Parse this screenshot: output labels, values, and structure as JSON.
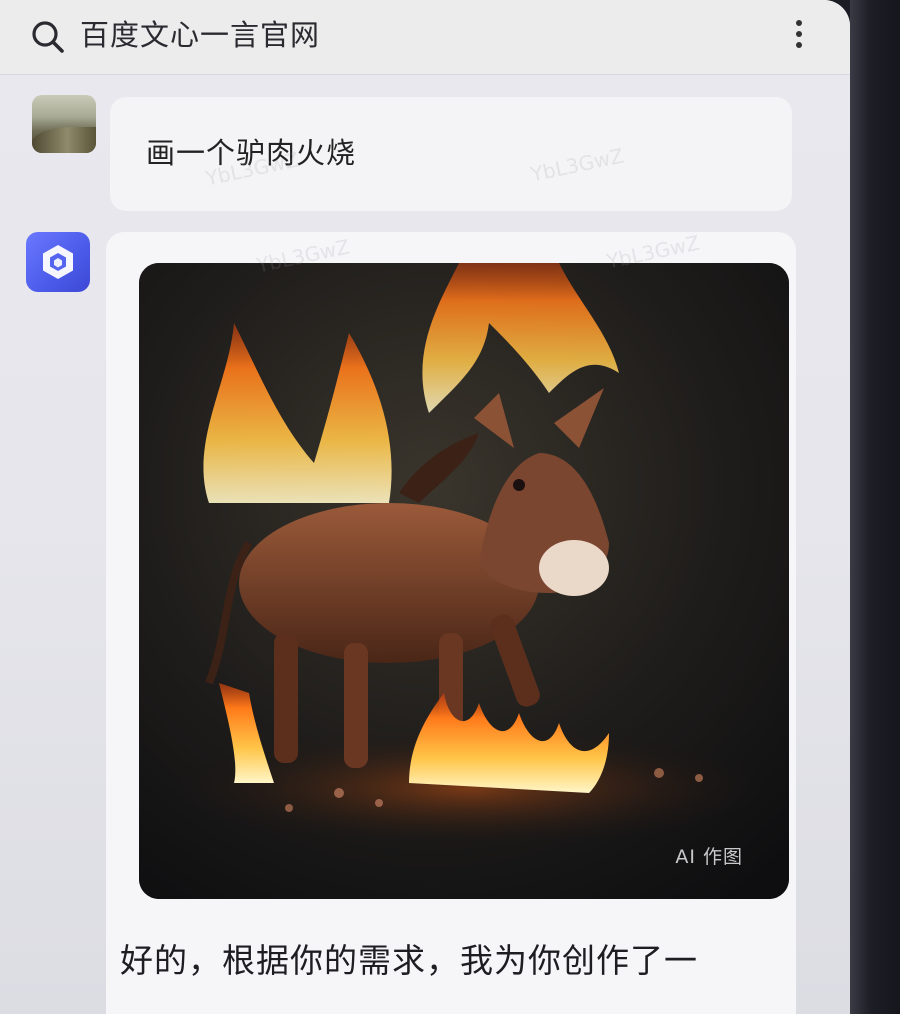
{
  "search": {
    "query": "百度文心一言官网",
    "icon": "search-icon",
    "menu_icon": "more-vertical-icon"
  },
  "conversation": {
    "user_message": "画一个驴肉火烧",
    "bot_image_label": "AI 作图",
    "bot_text": "好的，根据你的需求，我为你创作了一"
  },
  "watermarks": [
    "YbL3GwZ",
    "YbL3GwZ",
    "YbL3GwZ",
    "YbL3GwZ"
  ],
  "colors": {
    "bot_avatar": "#4b5be9",
    "bubble": "#f4f4f6",
    "background": "#e6e6ec"
  }
}
